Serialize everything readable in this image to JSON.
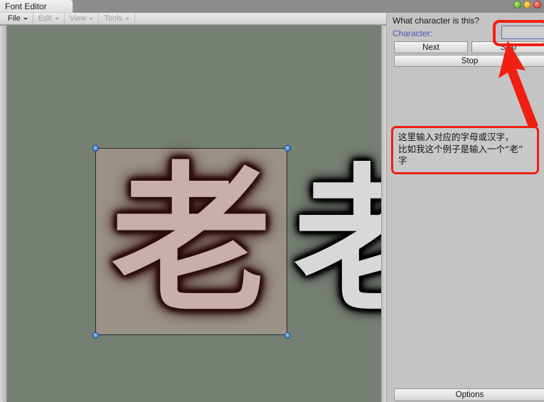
{
  "window": {
    "title": "Font Editor",
    "controls": [
      {
        "name": "minimize",
        "color": "#4aa919"
      },
      {
        "name": "maximize",
        "color": "#e09a08"
      },
      {
        "name": "close",
        "color": "#d62a1c"
      }
    ]
  },
  "menubar": {
    "items": [
      {
        "label": "File",
        "enabled": true
      },
      {
        "label": "Edit",
        "enabled": false
      },
      {
        "label": "View",
        "enabled": false
      },
      {
        "label": "Tools",
        "enabled": false
      }
    ]
  },
  "canvas": {
    "background_color": "#767f74",
    "selected_glyph": {
      "character": "老",
      "selected": true,
      "tile_color": "#9b9287",
      "ink_color": "#c9aeae",
      "outline_color": "#2b0d10"
    },
    "next_glyph": {
      "character": "老",
      "selected": false,
      "ink_color": "#d8d8d8",
      "outline_color": "#000000"
    }
  },
  "panel": {
    "question": "What character is this?",
    "character_label": "Character:",
    "character_input": {
      "value": "",
      "placeholder": "",
      "focused": true,
      "border_color": "#5a69b6"
    },
    "buttons": {
      "next": "Next",
      "skip": "Skip",
      "stop": "Stop",
      "options": "Options"
    },
    "background_color": "#c4c4c4",
    "label_color": "#4557b8"
  },
  "annotation": {
    "color": "#f01f12",
    "note_lines": [
      "这里输入对应的字母或汉字，",
      "比如我这个例子是输入一个“老”",
      "字"
    ],
    "note_text": "这里输入对应的字母或汉字，比如我这个例子是输入一个“老”字",
    "arrow": {
      "from": "note-box",
      "to": "character-input"
    },
    "highlight_target": "character-input"
  }
}
